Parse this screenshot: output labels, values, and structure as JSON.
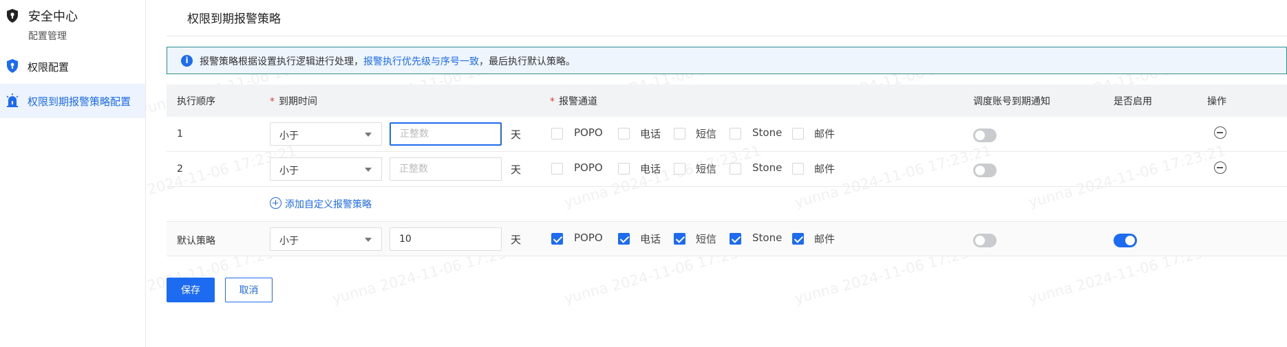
{
  "sidebar": {
    "title": "安全中心",
    "subtitle": "配置管理",
    "items": [
      {
        "label": "权限配置",
        "icon": "shield-icon"
      },
      {
        "label": "权限到期报警策略配置",
        "icon": "alarm-icon"
      }
    ]
  },
  "page": {
    "title": "权限到期报警策略"
  },
  "notice": {
    "prefix": "报警策略根据设置执行逻辑进行处理，",
    "highlight": "报警执行优先级与序号一致",
    "suffix": "，最后执行默认策略。"
  },
  "table": {
    "headers": {
      "order": "执行顺序",
      "expire": "到期时间",
      "channel": "报警通道",
      "notify": "调度账号到期通知",
      "enabled": "是否启用",
      "action": "操作"
    },
    "unit": "天",
    "channels": [
      "POPO",
      "电话",
      "短信",
      "Stone",
      "邮件"
    ],
    "rows": [
      {
        "order": "1",
        "compare": "小于",
        "days_placeholder": "正整数",
        "days_value": "",
        "channels_checked": [
          false,
          false,
          false,
          false,
          false
        ],
        "notify": false
      },
      {
        "order": "2",
        "compare": "小于",
        "days_placeholder": "正整数",
        "days_value": "",
        "channels_checked": [
          false,
          false,
          false,
          false,
          false
        ],
        "notify": false
      }
    ],
    "default_row": {
      "order": "默认策略",
      "compare": "小于",
      "days_value": "10",
      "channels_checked": [
        true,
        true,
        true,
        true,
        true
      ],
      "notify": false,
      "enabled": true
    }
  },
  "add_link": "添加自定义报警策略",
  "buttons": {
    "save": "保存",
    "cancel": "取消"
  },
  "watermark": "yunna 2024-11-06 17:23:21",
  "colors": {
    "accent": "#1d6bf0",
    "notice_border": "#2a8f8d",
    "required": "#e53935"
  }
}
